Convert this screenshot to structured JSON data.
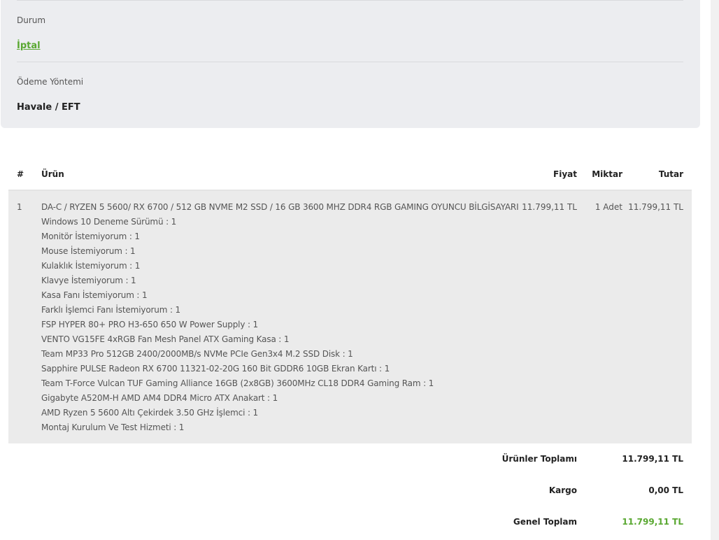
{
  "order_info": {
    "status_label": "Durum",
    "status_value": "İptal",
    "payment_label": "Ödeme Yöntemi",
    "payment_value": "Havale / EFT"
  },
  "table": {
    "headers": {
      "index": "#",
      "product": "Ürün",
      "price": "Fiyat",
      "quantity": "Miktar",
      "total": "Tutar"
    },
    "rows": [
      {
        "index": "1",
        "product": "DA-C / RYZEN 5 5600/ RX 6700 / 512 GB NVME M2 SSD / 16 GB 3600 MHZ DDR4 RGB GAMING OYUNCU BİLGİSAYARI",
        "options": [
          "Windows 10 Deneme Sürümü : 1",
          "Monitör İstemiyorum : 1",
          "Mouse İstemiyorum : 1",
          "Kulaklık İstemiyorum : 1",
          "Klavye İstemiyorum : 1",
          "Kasa Fanı İstemiyorum : 1",
          "Farklı İşlemci Fanı İstemiyorum : 1",
          "FSP HYPER 80+ PRO H3-650 650 W Power Supply : 1",
          "VENTO VG15FE 4xRGB Fan Mesh Panel ATX Gaming Kasa : 1",
          "Team MP33 Pro 512GB 2400/2000MB/s NVMe PCIe Gen3x4 M.2 SSD Disk : 1",
          "Sapphire PULSE Radeon RX 6700 11321-02-20G 160 Bit GDDR6 10GB Ekran Kartı : 1",
          "Team T-Force Vulcan TUF Gaming Alliance 16GB (2x8GB) 3600MHz CL18 DDR4 Gaming Ram : 1",
          "Gigabyte A520M-H AMD AM4 DDR4 Micro ATX Anakart : 1",
          "AMD Ryzen 5 5600 Altı Çekirdek 3.50 GHz İşlemci : 1",
          "Montaj Kurulum Ve Test Hizmeti : 1"
        ],
        "price": "11.799,11 TL",
        "quantity": "1 Adet",
        "total": "11.799,11 TL"
      }
    ]
  },
  "totals": {
    "subtotal_label": "Ürünler Toplamı",
    "subtotal_value": "11.799,11 TL",
    "shipping_label": "Kargo",
    "shipping_value": "0,00 TL",
    "grand_label": "Genel Toplam",
    "grand_value": "11.799,11 TL"
  },
  "colors": {
    "accent_green": "#5aa832",
    "card_bg": "#ecedf0",
    "row_bg": "#ebebeb"
  }
}
